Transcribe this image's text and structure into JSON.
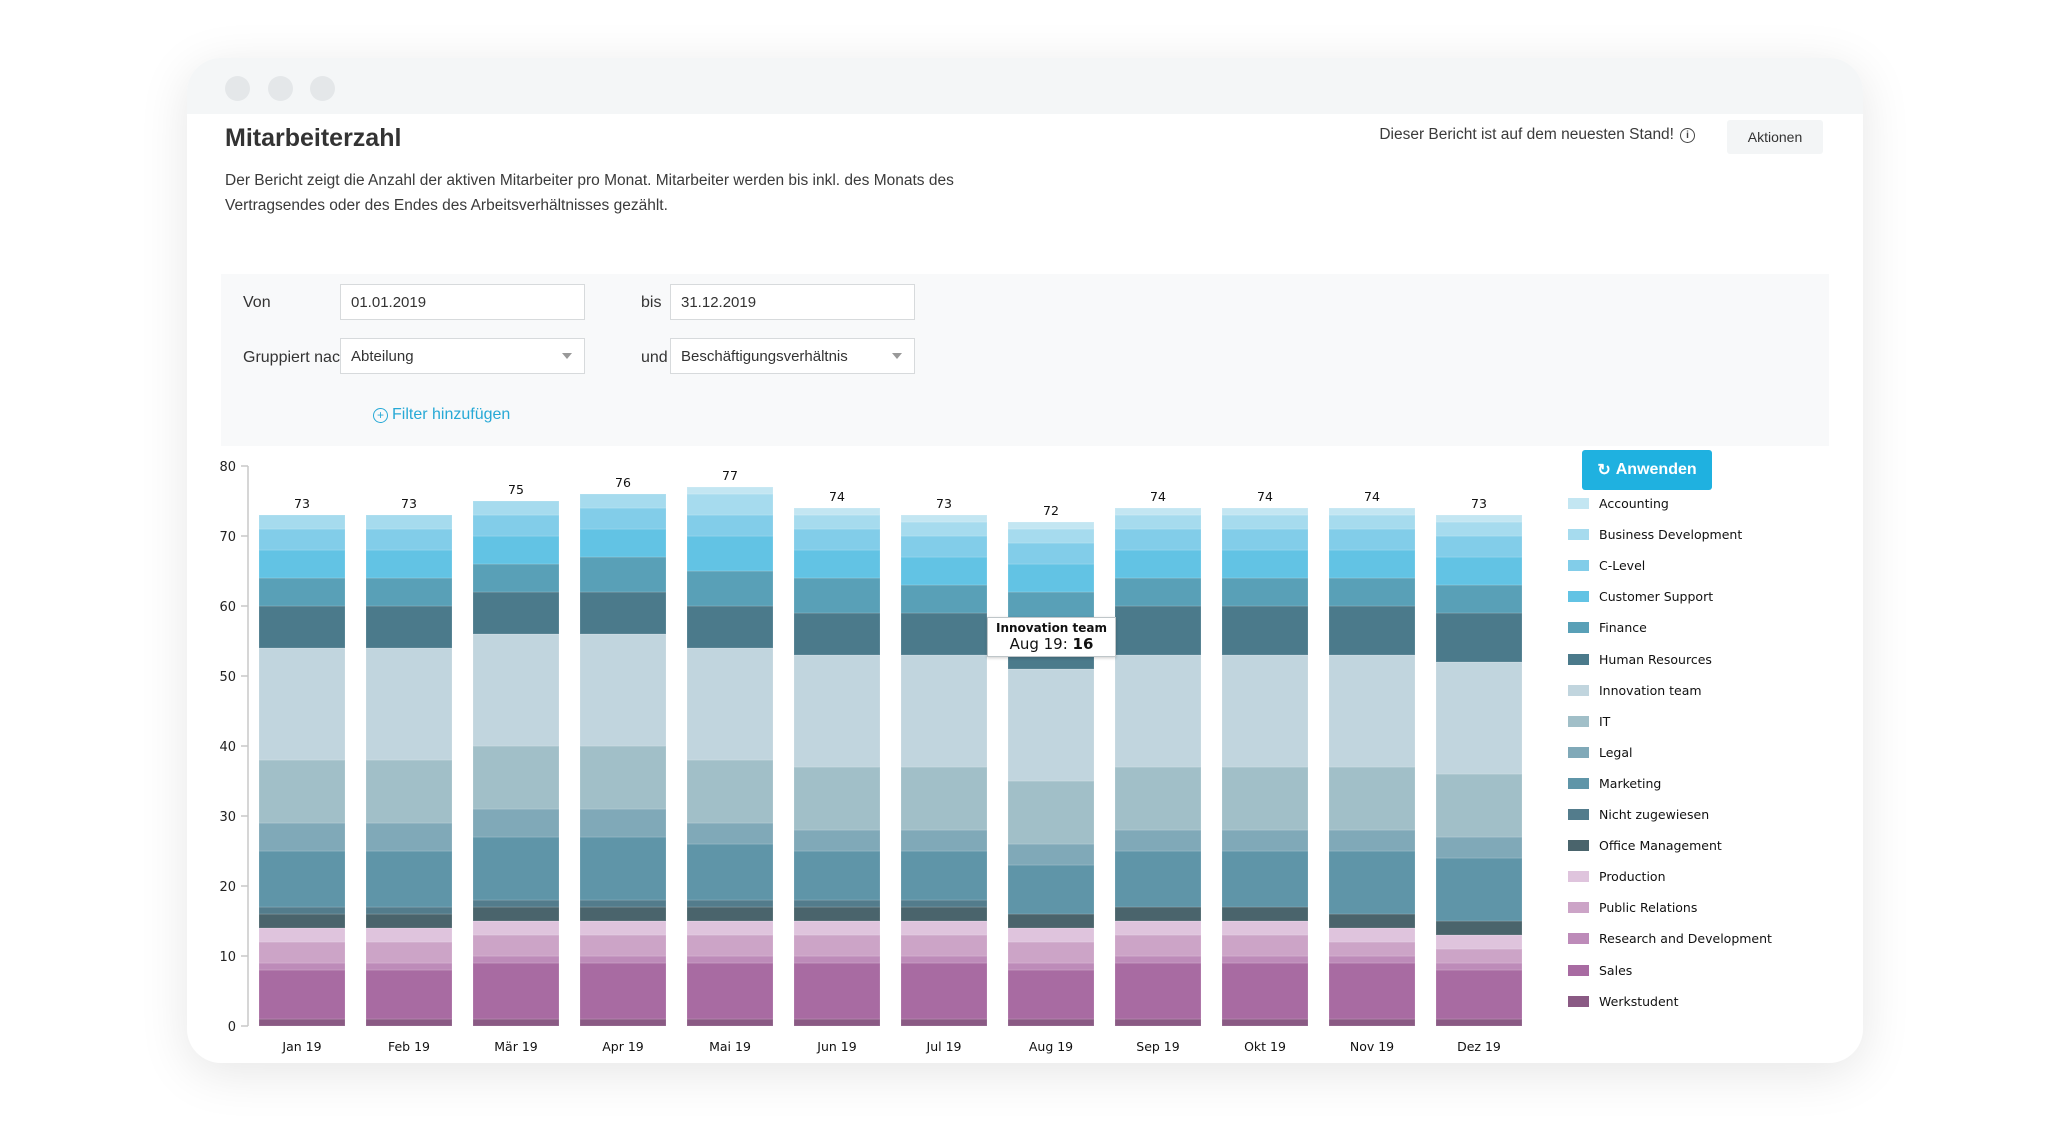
{
  "window": {
    "title": "Mitarbeiterzahl"
  },
  "header": {
    "title": "Mitarbeiterzahl",
    "description": "Der Bericht zeigt die Anzahl der aktiven Mitarbeiter pro Monat. Mitarbeiter werden bis inkl. des Monats des Vertragsendes oder des Endes des Arbeitsverhältnisses gezählt.",
    "status_text": "Dieser Bericht ist auf dem neuesten Stand!",
    "status_icon": "info-icon",
    "actions_label": "Aktionen"
  },
  "filters": {
    "from_label": "Von",
    "from_value": "01.01.2019",
    "to_label": "bis",
    "to_value": "31.12.2019",
    "group_label": "Gruppiert nach",
    "group_value": "Abteilung",
    "and_label": "und",
    "group2_value": "Beschäftigungsverhältnis",
    "add_filter_label": "Filter hinzufügen",
    "add_filter_icon": "plus-circle-icon",
    "apply_label": "Anwenden",
    "apply_icon": "refresh-icon",
    "accent_color": "#1fb1e0"
  },
  "tooltip": {
    "series": "Innovation team",
    "category": "Aug 19",
    "value": "16",
    "label_prefix": "Aug 19: "
  },
  "chart_data": {
    "type": "bar",
    "stacked": true,
    "title": "",
    "xlabel": "",
    "ylabel": "",
    "ylim": [
      0,
      80
    ],
    "yticks": [
      0,
      10,
      20,
      30,
      40,
      50,
      60,
      70,
      80
    ],
    "grid": false,
    "legend_position": "right",
    "categories": [
      "Jan 19",
      "Feb 19",
      "Mär 19",
      "Apr 19",
      "Mai 19",
      "Jun 19",
      "Jul 19",
      "Aug 19",
      "Sep 19",
      "Okt 19",
      "Nov 19",
      "Dez 19"
    ],
    "totals": [
      73,
      73,
      75,
      76,
      77,
      74,
      73,
      72,
      74,
      74,
      74,
      73
    ],
    "series": [
      {
        "name": "Werkstudent",
        "color": "#8a5a84",
        "values": [
          1,
          1,
          1,
          1,
          1,
          1,
          1,
          1,
          1,
          1,
          1,
          1
        ]
      },
      {
        "name": "Sales",
        "color": "#a86ba2",
        "values": [
          7,
          7,
          8,
          8,
          8,
          8,
          8,
          7,
          8,
          8,
          8,
          7
        ]
      },
      {
        "name": "Research and Development",
        "color": "#bd8bb9",
        "values": [
          1,
          1,
          1,
          1,
          1,
          1,
          1,
          1,
          1,
          1,
          1,
          1
        ]
      },
      {
        "name": "Public Relations",
        "color": "#cca4c7",
        "values": [
          3,
          3,
          3,
          3,
          3,
          3,
          3,
          3,
          3,
          3,
          2,
          2
        ]
      },
      {
        "name": "Production",
        "color": "#dfc4dd",
        "values": [
          2,
          2,
          2,
          2,
          2,
          2,
          2,
          2,
          2,
          2,
          2,
          2
        ]
      },
      {
        "name": "Office Management",
        "color": "#4a646c",
        "values": [
          2,
          2,
          2,
          2,
          2,
          2,
          2,
          2,
          2,
          2,
          2,
          2
        ]
      },
      {
        "name": "Nicht zugewiesen",
        "color": "#537c8c",
        "values": [
          1,
          1,
          1,
          1,
          1,
          1,
          1,
          0,
          0,
          0,
          0,
          0
        ]
      },
      {
        "name": "Marketing",
        "color": "#5f95a8",
        "values": [
          8,
          8,
          9,
          9,
          8,
          7,
          7,
          7,
          8,
          8,
          9,
          9
        ]
      },
      {
        "name": "Legal",
        "color": "#80a9b8",
        "values": [
          4,
          4,
          4,
          4,
          3,
          3,
          3,
          3,
          3,
          3,
          3,
          3
        ]
      },
      {
        "name": "IT",
        "color": "#a1bfc8",
        "values": [
          9,
          9,
          9,
          9,
          9,
          9,
          9,
          9,
          9,
          9,
          9,
          9
        ]
      },
      {
        "name": "Innovation team",
        "color": "#c1d5de",
        "values": [
          16,
          16,
          16,
          16,
          16,
          16,
          16,
          16,
          16,
          16,
          16,
          16
        ]
      },
      {
        "name": "Human Resources",
        "color": "#4b7a8b",
        "values": [
          6,
          6,
          6,
          6,
          6,
          6,
          6,
          5,
          7,
          7,
          7,
          7
        ]
      },
      {
        "name": "Finance",
        "color": "#59a0b7",
        "values": [
          4,
          4,
          4,
          5,
          5,
          5,
          4,
          6,
          4,
          4,
          4,
          4
        ]
      },
      {
        "name": "Customer Support",
        "color": "#62c3e4",
        "values": [
          4,
          4,
          4,
          4,
          5,
          4,
          4,
          4,
          4,
          4,
          4,
          4
        ]
      },
      {
        "name": "C-Level",
        "color": "#82cde9",
        "values": [
          3,
          3,
          3,
          3,
          3,
          3,
          3,
          3,
          3,
          3,
          3,
          3
        ]
      },
      {
        "name": "Business Development",
        "color": "#a6dbee",
        "values": [
          2,
          2,
          2,
          2,
          3,
          2,
          2,
          2,
          2,
          2,
          2,
          2
        ]
      },
      {
        "name": "Accounting",
        "color": "#c3e6f2",
        "values": [
          0,
          0,
          0,
          0,
          1,
          1,
          1,
          1,
          1,
          1,
          1,
          1
        ]
      }
    ]
  }
}
